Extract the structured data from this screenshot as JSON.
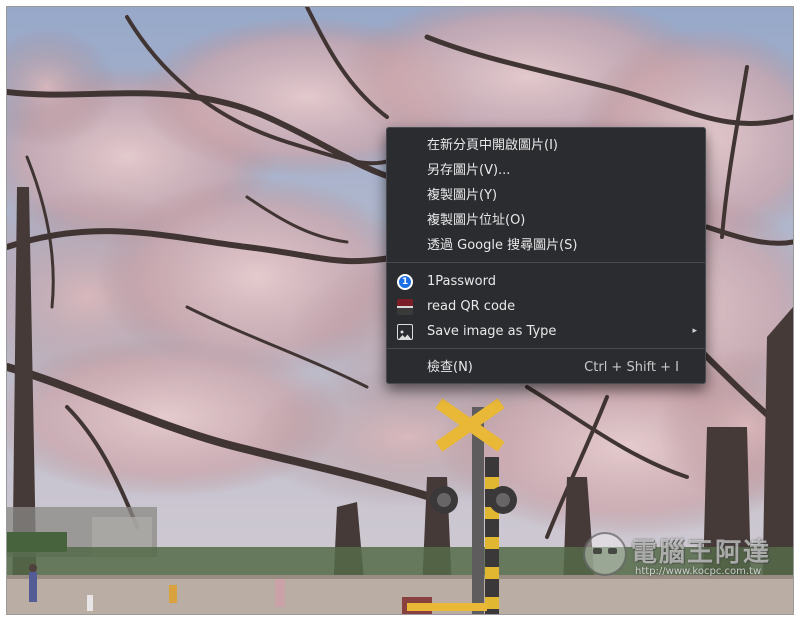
{
  "context_menu": {
    "items": [
      {
        "label": "在新分頁中開啟圖片(I)"
      },
      {
        "label": "另存圖片(V)..."
      },
      {
        "label": "複製圖片(Y)"
      },
      {
        "label": "複製圖片位址(O)"
      },
      {
        "label": "透過 Google 搜尋圖片(S)"
      }
    ],
    "extensions": [
      {
        "label": "1Password",
        "icon": "1password-icon",
        "icon_glyph": "1"
      },
      {
        "label": "read QR code",
        "icon": "qr-code-icon"
      },
      {
        "label": "Save image as Type",
        "icon": "image-icon",
        "submenu_arrow": "▸"
      }
    ],
    "inspect": {
      "label": "檢查(N)",
      "shortcut": "Ctrl + Shift + I"
    },
    "colors": {
      "background": "#2b2c30",
      "text": "#e8e8e8",
      "separator": "#4a4b50",
      "onepassword_blue": "#1a6ee6"
    }
  },
  "photo": {
    "subject": "cherry blossom trees with railway crossing sign"
  },
  "watermark": {
    "title": "電腦王阿達",
    "url": "http://www.kocpc.com.tw"
  }
}
